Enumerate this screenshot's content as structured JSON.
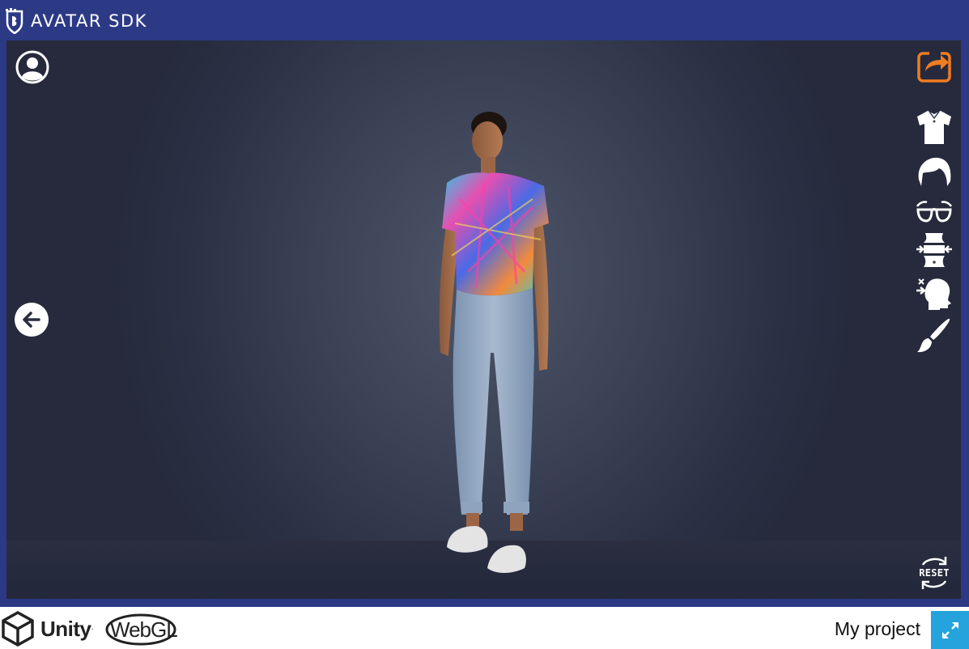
{
  "header": {
    "title": "AVATAR SDK",
    "logo_icon": "avatar-sdk-shield-logo"
  },
  "viewer": {
    "background": "#3c4256",
    "left_buttons": [
      {
        "icon": "user-profile-icon"
      },
      {
        "icon": "arrow-left-icon"
      }
    ],
    "right_toolbar": [
      {
        "icon": "share-icon",
        "color": "#f07c22"
      },
      {
        "icon": "shirt-icon"
      },
      {
        "icon": "hair-icon"
      },
      {
        "icon": "glasses-icon"
      },
      {
        "icon": "body-shape-icon"
      },
      {
        "icon": "head-shape-icon"
      },
      {
        "icon": "paint-brush-icon"
      }
    ],
    "reset_label": "RESET"
  },
  "footer": {
    "unity_label": "Unity",
    "webgl_label": "WebGL",
    "project_name": "My project",
    "fullscreen_icon": "fullscreen-icon"
  },
  "colors": {
    "frame": "#2c3a85",
    "accent": "#f07c22",
    "fullscreen": "#25a3dc"
  }
}
